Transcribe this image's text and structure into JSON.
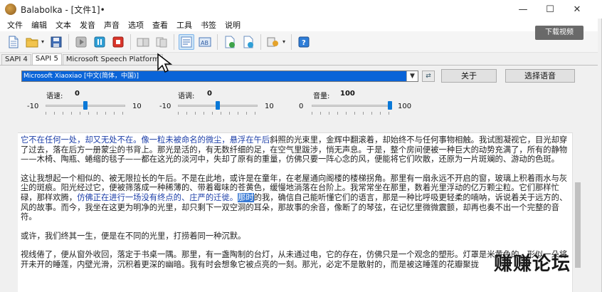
{
  "window": {
    "title": "Balabolka - [文件1]•",
    "controls": [
      "—",
      "☐",
      "✕"
    ]
  },
  "menu": [
    "文件",
    "编辑",
    "文本",
    "发音",
    "声音",
    "选项",
    "查看",
    "工具",
    "书签",
    "说明"
  ],
  "toolbar": {
    "buttons": [
      "new-file",
      "open-file",
      "save-file",
      "play",
      "pause",
      "stop",
      "read-clipboard",
      "read-file",
      "speak-selection",
      "spell-check",
      "convert-audio",
      "split-convert",
      "batch-help",
      "help"
    ],
    "active": "speak-selection"
  },
  "tabs": [
    "SAPI 4",
    "SAPI 5",
    "Microsoft Speech Platform"
  ],
  "selected_tab": "SAPI 5",
  "voice": {
    "selected": "Microsoft Xiaoxiao [中文(简体，中国)]",
    "about_label": "关于",
    "choose_label": "选择语音"
  },
  "sliders": {
    "rate": {
      "label": "语速:",
      "value": "0",
      "min": "-10",
      "max": "10",
      "fraction": 0.5
    },
    "pitch": {
      "label": "语调:",
      "value": "0",
      "min": "-10",
      "max": "10",
      "fraction": 0.5
    },
    "volume": {
      "label": "音量:",
      "value": "100",
      "min": "0",
      "max": "100",
      "fraction": 1.0
    }
  },
  "text": {
    "p1_highlight": "它不在任何一处，却又无处不在。像一粒未被命名的微尘，悬浮在午后",
    "p1_rest": "斜照的光束里，金辉中翻滚着，却始终不与任何事物相触。我试图凝视它，目光却穿了过去，落在后方一册蒙尘的书背上。那光是活的，有无数纤细的足，在空气里跋涉，悄无声息。于是，整个房间便被一种巨大的动势充满了，所有的静物——木椅、陶瓶、蜷缩的毯子——都在这光的淡河中，失却了原有的重量，仿佛只要一阵心念的风，便能将它们吹散，还原为一片斑斓的、游动的色斑。",
    "p2_before": "这让我想起一个相似的、被无限拉长的午后。不是在此地，或许是在童年，在老屋通向阁楼的楼梯拐角。那里有一扇永远不开启的窗，玻璃上积着雨水与灰尘的斑痕。阳光经过它，便被筛落成一种稀薄的、带着霉味的苍黄色，缓慢地淌落在台阶上。我常常坐在那里，数着光里浮动的亿万颗尘粒。它们那样忙碌，那样欢腾，",
    "p2_highlight": "仿佛正在进行一场没有终点的、庄严的迁徙。",
    "p2_selected": "那时",
    "p2_after": "的我，确信自己能听懂它们的语言，那是一种比呼吸更轻柔的喃呐，诉说着关于远方的、风的故事。而今，我坐在这更为明净的光里，却只剩下一双空洞的耳朵，那故事的余音，像断了的琴弦，在记忆里微微震颤，却再也奏不出一个完整的音符。",
    "p3": "或许，我们终其一生，便是在不同的光里，打捞着同一种沉默。",
    "p4": "视线倦了，便从窗外收回，落定于书桌一隅。那里，有一盏陶制的台灯，从未通过电，它的存在，仿佛只是一个观念的塑形。灯罩是米黄色的，形似一朵将开未开的睡莲，内壁光滑，沉积着更深的幽暗。我有时会想象它被点亮的一刻。那光，必定不是散射的，而是被这睡莲的花瓣聚拢"
  },
  "overlay": {
    "download_label": "下载视频",
    "watermark": "赚赚论坛"
  }
}
